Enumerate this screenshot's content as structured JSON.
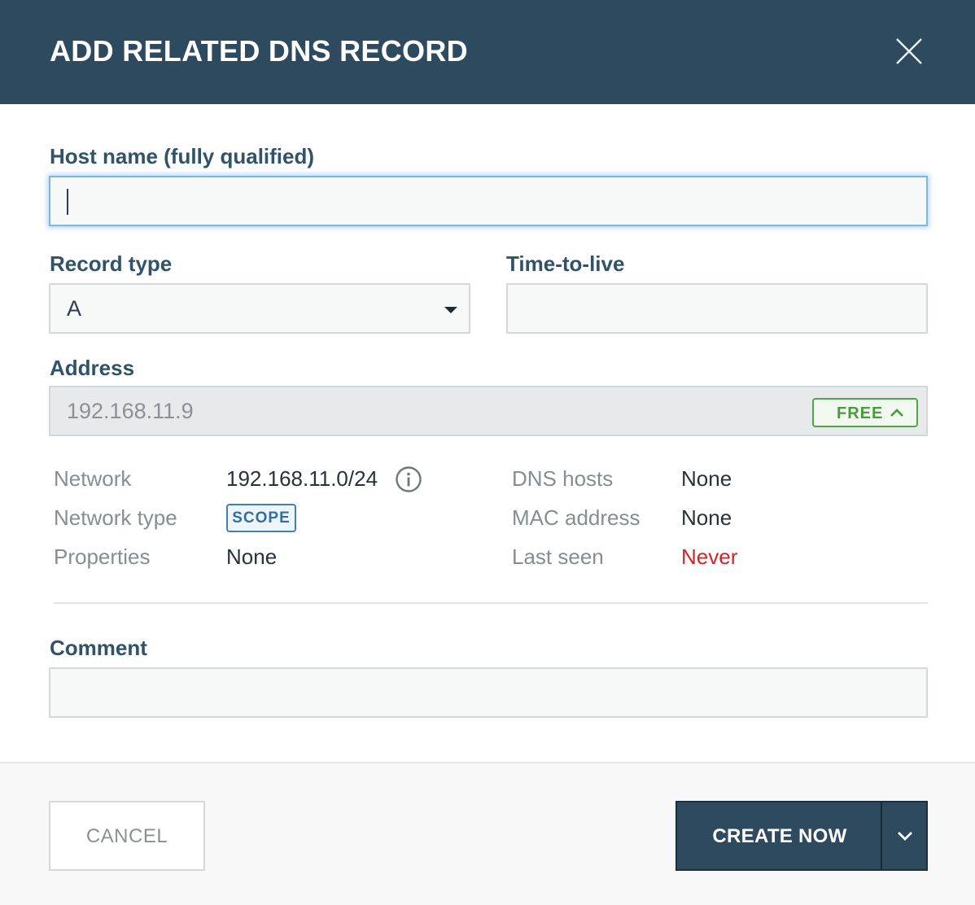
{
  "dialog": {
    "title": "ADD RELATED DNS RECORD"
  },
  "host_name": {
    "label": "Host name (fully qualified)",
    "value": ""
  },
  "record_type": {
    "label": "Record type",
    "value": "A"
  },
  "ttl": {
    "label": "Time-to-live",
    "value": ""
  },
  "address": {
    "label": "Address",
    "value": "192.168.11.9",
    "status_badge": "FREE"
  },
  "details": {
    "network_label": "Network",
    "network_value": "192.168.11.0/24",
    "network_type_label": "Network type",
    "network_type_badge": "SCOPE",
    "properties_label": "Properties",
    "properties_value": "None",
    "dns_hosts_label": "DNS hosts",
    "dns_hosts_value": "None",
    "mac_address_label": "MAC address",
    "mac_address_value": "None",
    "last_seen_label": "Last seen",
    "last_seen_value": "Never"
  },
  "comment": {
    "label": "Comment",
    "value": ""
  },
  "footer": {
    "cancel_label": "CANCEL",
    "create_label": "CREATE NOW"
  },
  "colors": {
    "header_bg": "#2e4a5e",
    "free_green": "#4a9a3e",
    "scope_blue": "#2f6ea8",
    "never_red": "#d0252b"
  }
}
